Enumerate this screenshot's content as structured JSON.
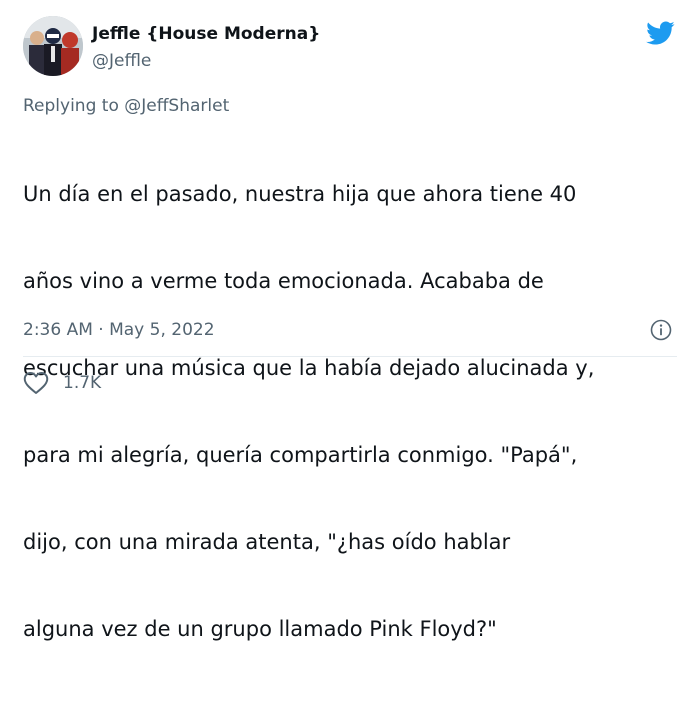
{
  "author": {
    "name": "Jeffle {House Moderna}",
    "handle": "@Jeffle"
  },
  "reply": {
    "prefix": "Replying to ",
    "handle": "@JeffSharlet"
  },
  "tweet": {
    "lines": [
      "Un día en el pasado, nuestra hija que ahora tiene 40",
      "años vino a verme toda emocionada. Acababa de",
      "escuchar una música que la había dejado alucinada y,",
      "para mi alegría, quería compartirla conmigo. \"Papá\",",
      "dijo, con una mirada atenta, \"¿has oído hablar",
      "alguna vez de un grupo llamado Pink Floyd?\""
    ]
  },
  "meta": {
    "timestamp": "2:36 AM · May 5, 2022"
  },
  "actions": {
    "like_count": "1.7K"
  },
  "icons": {
    "brand": "twitter-bird-icon",
    "info": "info-icon",
    "like": "heart-icon"
  },
  "colors": {
    "brand_blue": "#1d9bf0",
    "text_primary": "#0f1419",
    "text_secondary": "#536471",
    "divider": "#e6ecf0"
  }
}
